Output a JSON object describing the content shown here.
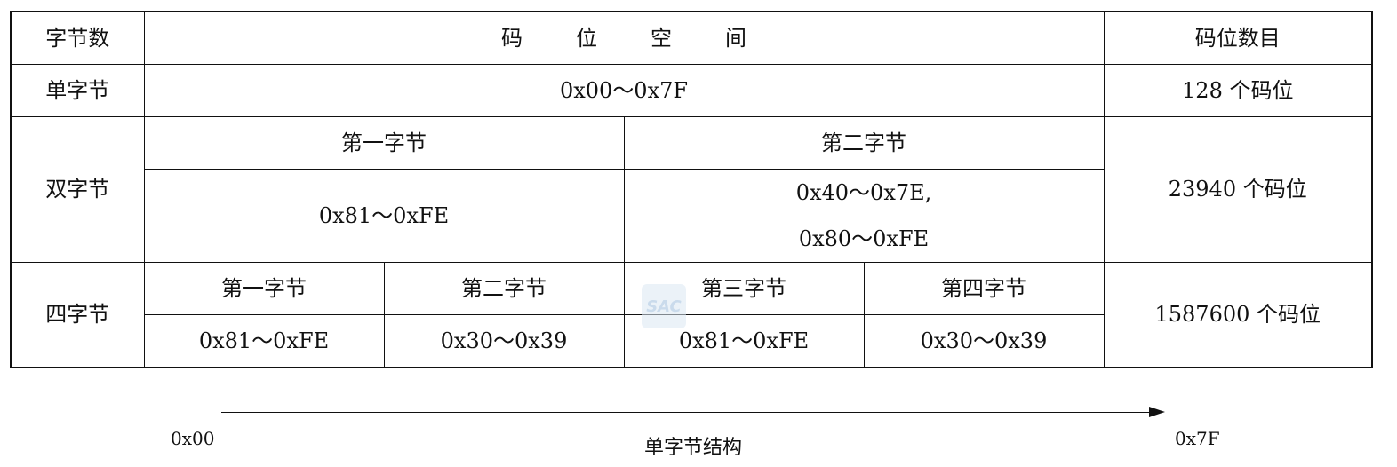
{
  "table": {
    "header": {
      "bytes": "字节数",
      "space": "码位空间",
      "count": "码位数目"
    },
    "single": {
      "label": "单字节",
      "range": "0x00～0x7F",
      "count": "128 个码位"
    },
    "double": {
      "label": "双字节",
      "first_head": "第一字节",
      "second_head": "第二字节",
      "first_range": "0x81～0xFE",
      "second_range_1": "0x40～0x7E,",
      "second_range_2": "0x80～0xFE",
      "count": "23940 个码位"
    },
    "quad": {
      "label": "四字节",
      "h1": "第一字节",
      "h2": "第二字节",
      "h3": "第三字节",
      "h4": "第四字节",
      "r1": "0x81～0xFE",
      "r2": "0x30～0x39",
      "r3": "0x81～0xFE",
      "r4": "0x30～0x39",
      "count": "1587600 个码位"
    }
  },
  "watermark": "SAC",
  "diagram": {
    "start": "0x00",
    "end": "0x7F",
    "caption": "单字节结构"
  }
}
